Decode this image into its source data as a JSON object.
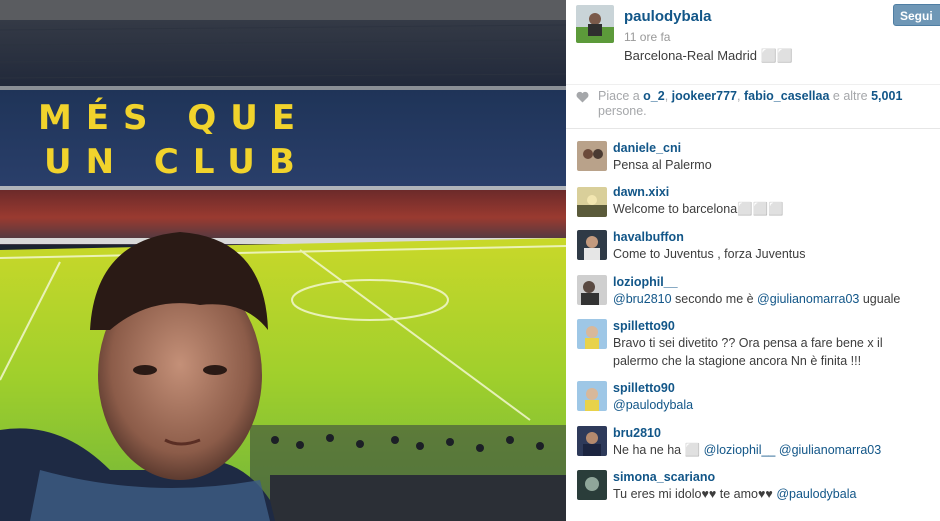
{
  "post": {
    "username": "paulodybala",
    "time": "11 ore fa",
    "caption": "Barcelona-Real Madrid ⬜⬜",
    "follow_label": "Segui",
    "photo_banner": {
      "line1": "MÉS QUE",
      "line2": "UN CLUB"
    }
  },
  "likes": {
    "prefix": "Piace a ",
    "user1": "o_2",
    "sep1": ", ",
    "user2": "jookeer777",
    "sep2": ", ",
    "user3": "fabio_casellaa",
    "middle": " e altre ",
    "count": "5,001",
    "suffix": " persone."
  },
  "comments": [
    {
      "user": "daniele_cni",
      "parts": [
        {
          "t": "Pensa al Palermo"
        }
      ]
    },
    {
      "user": "dawn.xixi",
      "parts": [
        {
          "t": "Welcome to barcelona⬜⬜⬜"
        }
      ]
    },
    {
      "user": "havalbuffon",
      "parts": [
        {
          "t": "Come to Juventus , forza Juventus"
        }
      ]
    },
    {
      "user": "loziophil__",
      "parts": [
        {
          "t": "@bru2810",
          "m": true
        },
        {
          "t": " secondo me è "
        },
        {
          "t": "@giulianomarra03",
          "m": true
        },
        {
          "t": " uguale"
        }
      ]
    },
    {
      "user": "spilletto90",
      "parts": [
        {
          "t": "Bravo ti sei divetito ?? Ora pensa a fare bene x il palermo che la stagione ancora Nn è finita !!!"
        }
      ]
    },
    {
      "user": "spilletto90",
      "parts": [
        {
          "t": "@paulodybala",
          "m": true
        }
      ]
    },
    {
      "user": "bru2810",
      "parts": [
        {
          "t": "Ne ha ne ha ⬜ "
        },
        {
          "t": "@loziophil__",
          "m": true
        },
        {
          "t": " "
        },
        {
          "t": "@giulianomarra03",
          "m": true
        }
      ]
    },
    {
      "user": "simona_scariano",
      "parts": [
        {
          "t": "Tu eres mi idolo♥♥ te amo♥♥ "
        },
        {
          "t": "@paulodybala",
          "m": true
        }
      ]
    }
  ],
  "colors": {
    "username_blue": "#125688",
    "follow_button": "#6f97b6"
  }
}
